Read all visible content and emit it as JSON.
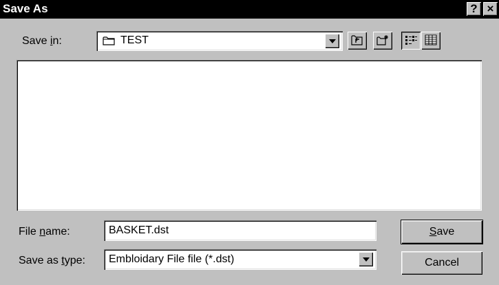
{
  "window": {
    "title": "Save As",
    "help_button": "?",
    "close_button": "×"
  },
  "save_in": {
    "label_pre": "Save ",
    "label_ul": "i",
    "label_post": "n:",
    "value": "TEST",
    "icon": "folder-icon"
  },
  "toolbar": {
    "up_one_level_icon": "up-folder-icon",
    "new_folder_icon": "new-folder-icon",
    "list_view_icon": "list-view-icon",
    "details_view_icon": "details-view-icon"
  },
  "file_list": {
    "items": []
  },
  "file_name": {
    "label_pre": "File ",
    "label_ul": "n",
    "label_post": "ame:",
    "value": "BASKET.dst"
  },
  "save_as_type": {
    "label_pre": "Save as ",
    "label_ul": "t",
    "label_post": "ype:",
    "value": "Embloidary File file (*.dst)"
  },
  "buttons": {
    "save_ul": "S",
    "save_post": "ave",
    "cancel": "Cancel"
  }
}
